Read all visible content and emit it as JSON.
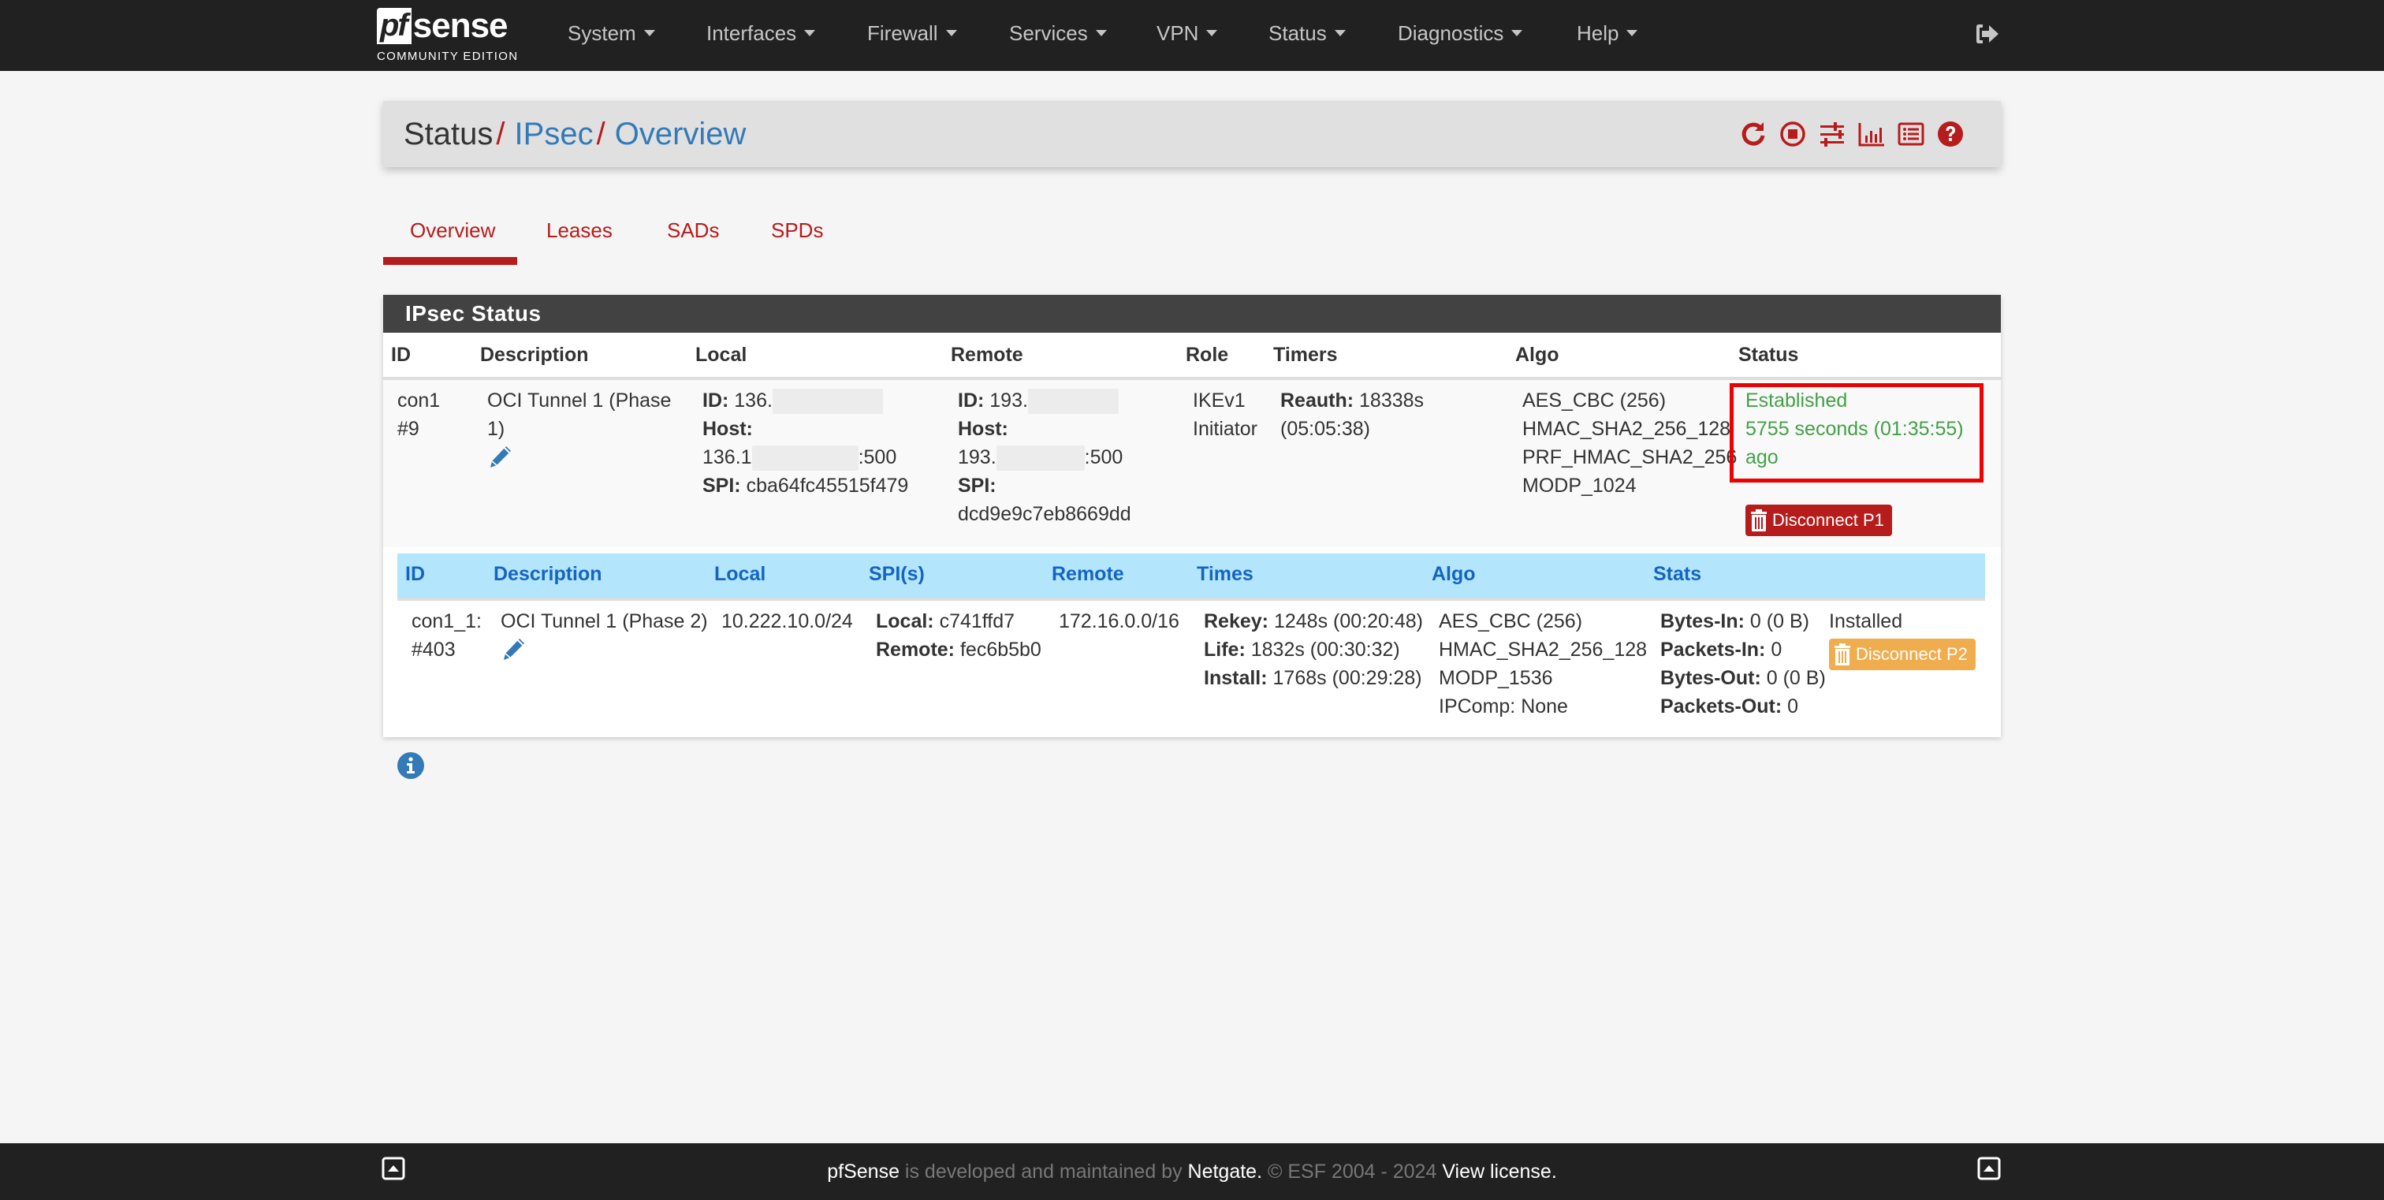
{
  "navbar": {
    "logo": {
      "mark": "pf",
      "wordmark": "sense",
      "edition": "COMMUNITY EDITION"
    },
    "menu": [
      {
        "label": "System"
      },
      {
        "label": "Interfaces"
      },
      {
        "label": "Firewall"
      },
      {
        "label": "Services"
      },
      {
        "label": "VPN"
      },
      {
        "label": "Status"
      },
      {
        "label": "Diagnostics"
      },
      {
        "label": "Help"
      }
    ],
    "logout_icon": "sign-out-icon"
  },
  "breadcrumb": {
    "items": [
      {
        "label": "Status",
        "link": false
      },
      {
        "label": "IPsec",
        "link": true
      },
      {
        "label": "Overview",
        "link": true
      }
    ],
    "separator": "/",
    "actions": [
      {
        "name": "restart-service",
        "icon": "redo-icon"
      },
      {
        "name": "stop-service",
        "icon": "stop-circle-icon"
      },
      {
        "name": "settings",
        "icon": "sliders-icon"
      },
      {
        "name": "graph",
        "icon": "bar-chart-icon"
      },
      {
        "name": "logs",
        "icon": "list-alt-icon"
      },
      {
        "name": "help",
        "icon": "question-circle-icon"
      }
    ]
  },
  "tabs": [
    {
      "label": "Overview",
      "active": true
    },
    {
      "label": "Leases",
      "active": false
    },
    {
      "label": "SADs",
      "active": false
    },
    {
      "label": "SPDs",
      "active": false
    }
  ],
  "panel": {
    "title": "IPsec Status",
    "columns": [
      "ID",
      "Description",
      "Local",
      "Remote",
      "Role",
      "Timers",
      "Algo",
      "Status"
    ],
    "phase1": {
      "id": [
        "con1",
        "#9"
      ],
      "description": [
        "OCI Tunnel 1 (Phase",
        "1)"
      ],
      "local": {
        "id_label": "ID:",
        "id_value": "136.",
        "host_label": "Host:",
        "host_prefix": "136.1",
        "host_suffix": ":500",
        "spi_label": "SPI:",
        "spi_value": "cba64fc45515f479"
      },
      "remote": {
        "id_label": "ID:",
        "id_value": "193.",
        "host_label": "Host:",
        "host_prefix": "193.",
        "host_suffix": ":500",
        "spi_label": "SPI:",
        "spi_value": "dcd9e9c7eb8669dd"
      },
      "role": [
        "IKEv1",
        "Initiator"
      ],
      "timers": {
        "label": "Reauth:",
        "value": "18338s",
        "formatted": "(05:05:38)"
      },
      "algo": [
        "AES_CBC (256)",
        "HMAC_SHA2_256_128",
        "PRF_HMAC_SHA2_256",
        "MODP_1024"
      ],
      "status": [
        "Established",
        "5755 seconds (01:35:55)",
        "ago"
      ],
      "status_color": "#43a047",
      "disconnect_label": "Disconnect P1"
    },
    "phase2": {
      "columns": [
        "ID",
        "Description",
        "Local",
        "SPI(s)",
        "Remote",
        "Times",
        "Algo",
        "Stats"
      ],
      "id": [
        "con1_1:",
        "#403"
      ],
      "description": "OCI Tunnel 1 (Phase 2)",
      "local": "10.222.10.0/24",
      "spis": [
        {
          "label": "Local:",
          "value": "c741ffd7"
        },
        {
          "label": "Remote:",
          "value": "fec6b5b0"
        }
      ],
      "remote": "172.16.0.0/16",
      "times": [
        {
          "label": "Rekey:",
          "value": "1248s (00:20:48)"
        },
        {
          "label": "Life:",
          "value": "1832s (00:30:32)"
        },
        {
          "label": "Install:",
          "value": "1768s (00:29:28)"
        }
      ],
      "algo": [
        "AES_CBC (256)",
        "HMAC_SHA2_256_128",
        "MODP_1536",
        "IPComp: None"
      ],
      "stats": [
        {
          "label": "Bytes-In:",
          "value": "0 (0 B)"
        },
        {
          "label": "Packets-In:",
          "value": "0"
        },
        {
          "label": "Bytes-Out:",
          "value": "0 (0 B)"
        },
        {
          "label": "Packets-Out:",
          "value": "0"
        }
      ],
      "state": "Installed",
      "disconnect_label": "Disconnect P2"
    }
  },
  "footer": {
    "brand": "pfSense",
    "text1": " is developed and maintained by ",
    "company": "Netgate.",
    "text2": " © ESF 2004 - 2024 ",
    "license_link": "View license."
  },
  "colors": {
    "navbar_bg": "#212121",
    "accent_red": "#b71c1c",
    "link_blue": "#337ab7",
    "status_green": "#43a047",
    "phase2_header_bg": "#b3e5fc",
    "warning_orange": "#f0ad4e",
    "highlight_box": "#ee0000"
  }
}
